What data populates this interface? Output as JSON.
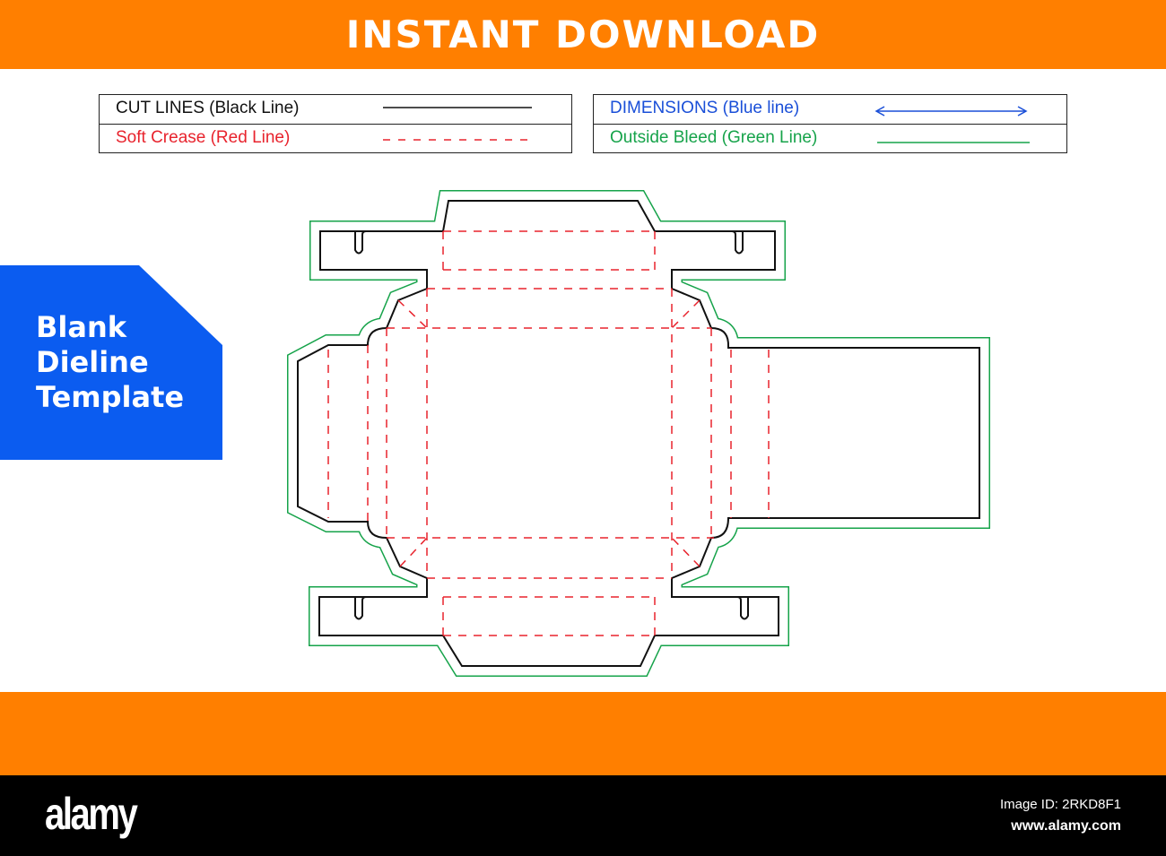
{
  "header": {
    "title": "INSTANT DOWNLOAD"
  },
  "legend": {
    "cut_lines": "CUT LINES (Black Line)",
    "soft_crease": "Soft Crease (Red Line)",
    "dimensions": "DIMENSIONS (Blue line)",
    "outside_bleed": "Outside Bleed (Green Line)"
  },
  "badge": {
    "line1": "Blank",
    "line2": "Dieline",
    "line3": "Template"
  },
  "footer": {
    "logo": "alamy",
    "image_id": "Image ID: 2RKD8F1",
    "site": "www.alamy.com"
  },
  "colors": {
    "orange": "#ff7f00",
    "blue": "#0b5cf0",
    "cut": "#111111",
    "crease": "#e8232d",
    "dimension": "#1a4fd8",
    "bleed": "#16a34a"
  }
}
